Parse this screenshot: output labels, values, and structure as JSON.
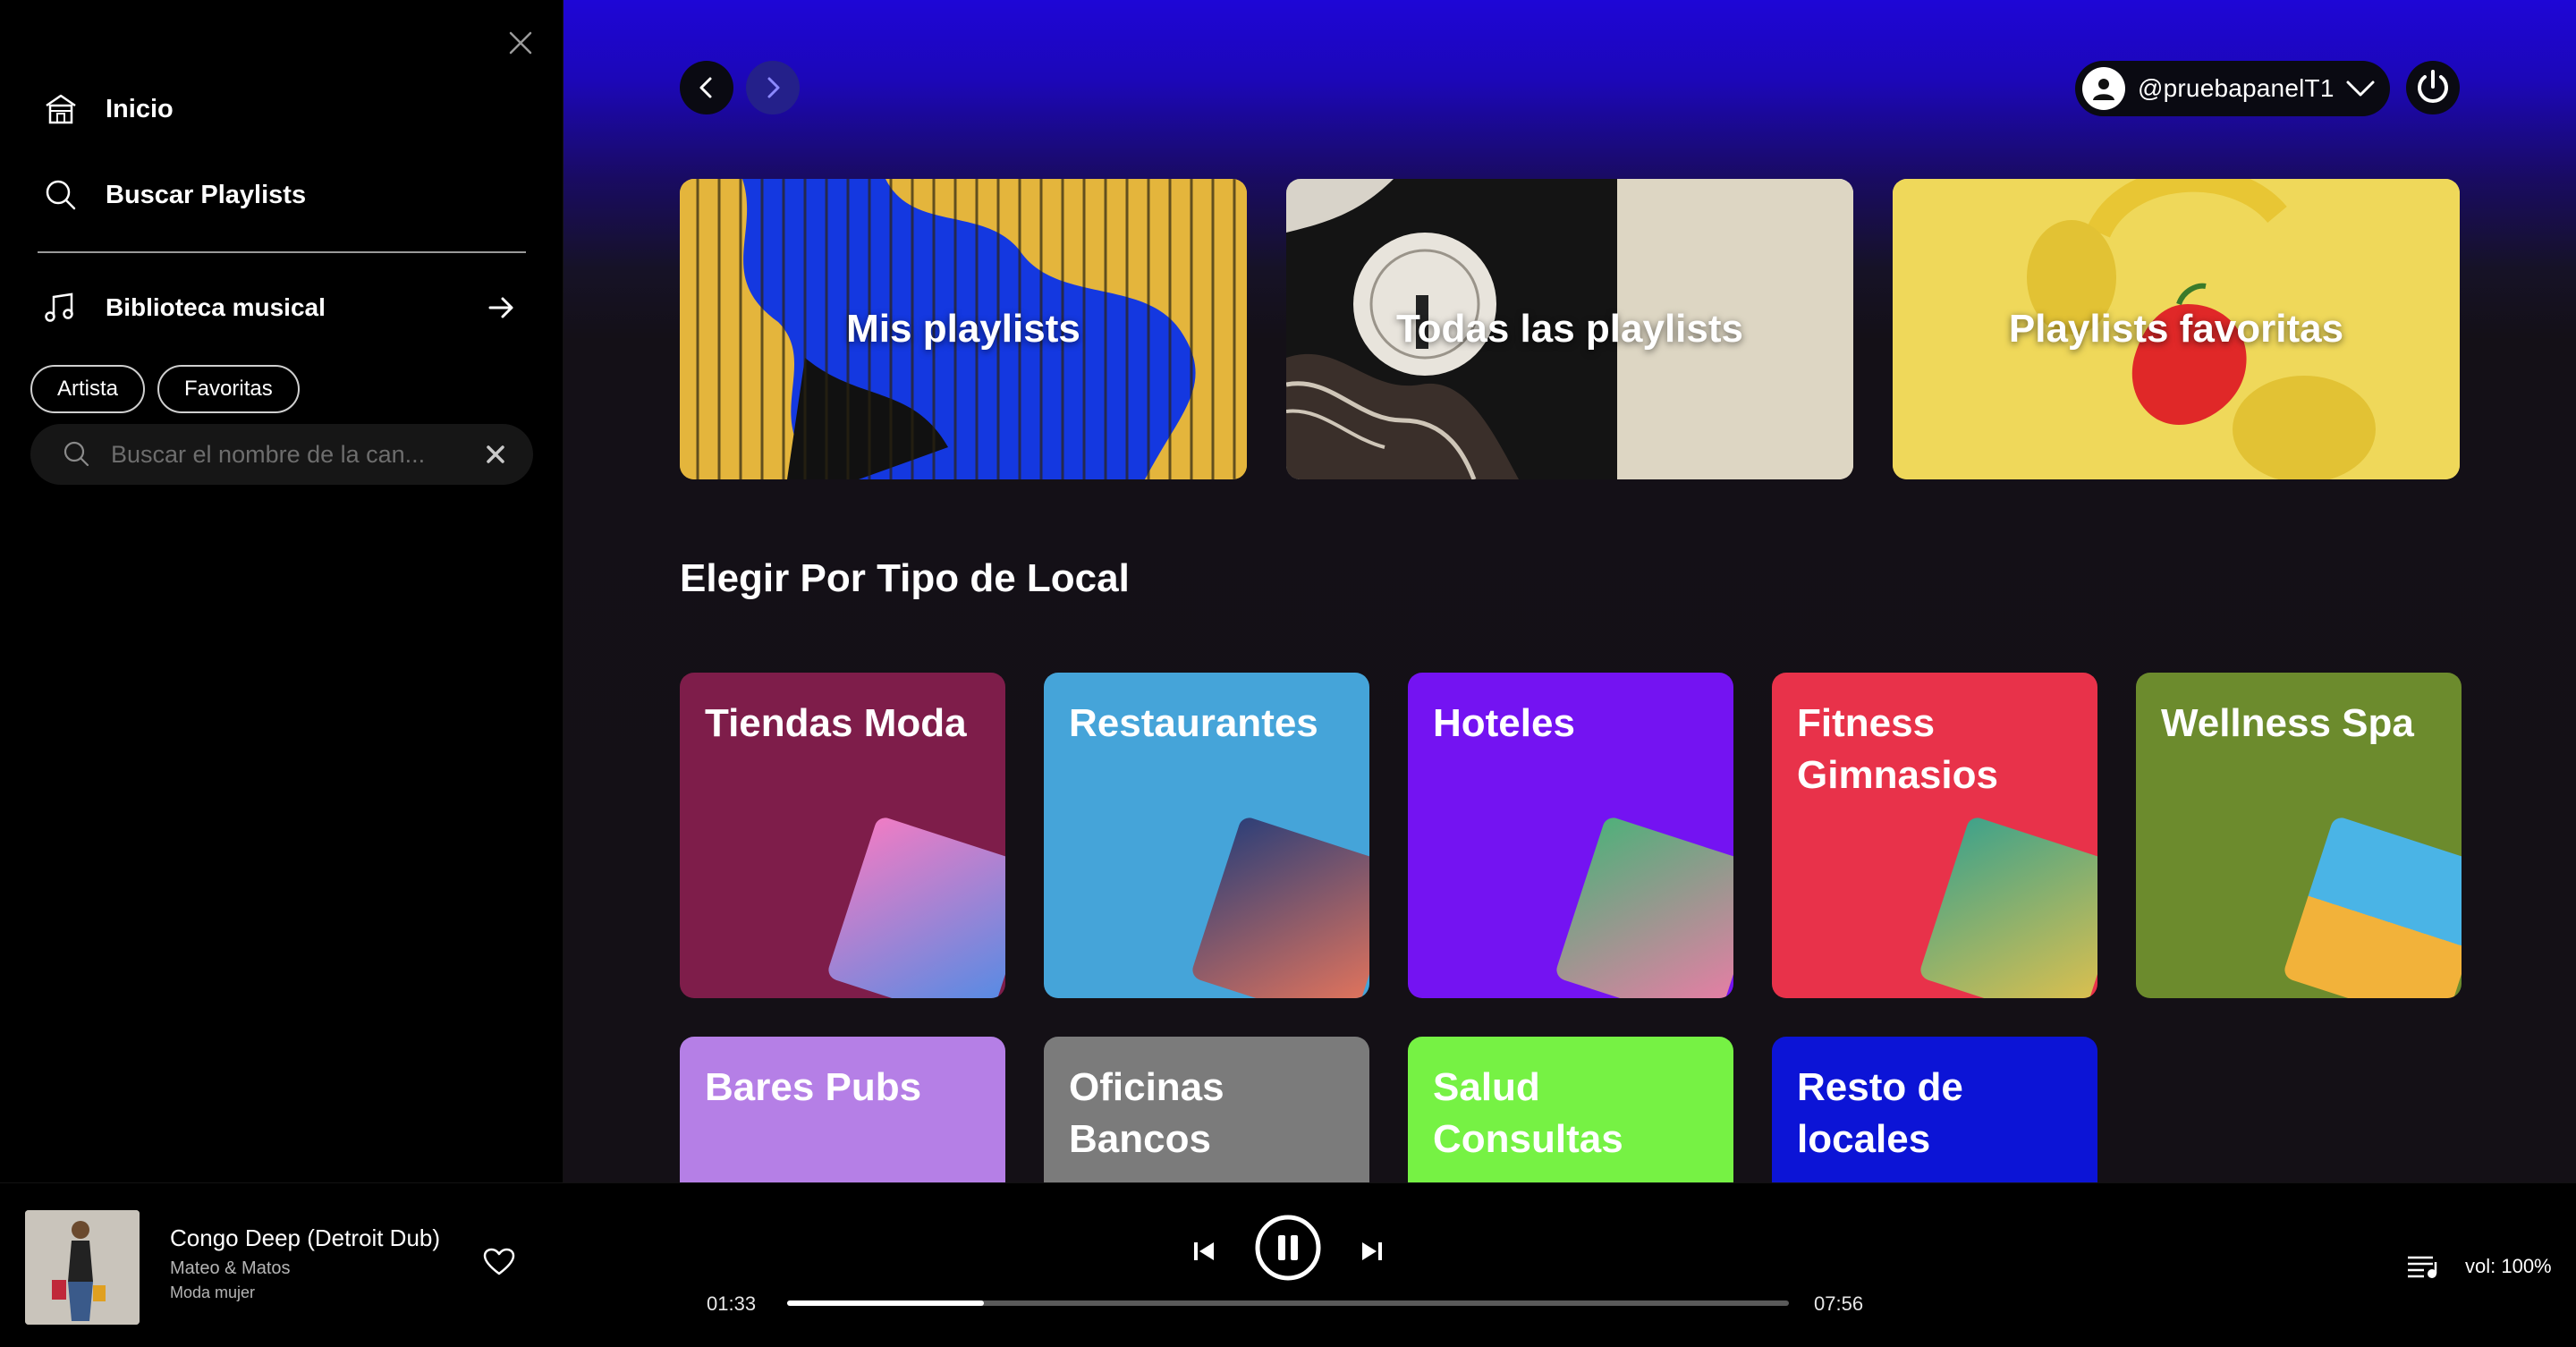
{
  "sidebar": {
    "nav": [
      {
        "label": "Inicio",
        "icon": "home-icon"
      },
      {
        "label": "Buscar Playlists",
        "icon": "search-icon"
      }
    ],
    "library": {
      "label": "Biblioteca musical",
      "icon": "music-note-icon"
    },
    "filters": [
      "Artista",
      "Favoritas"
    ],
    "search": {
      "placeholder": "Buscar el nombre de la can...",
      "value": ""
    }
  },
  "header": {
    "username": "@pruebapanelT1"
  },
  "hero_cards": [
    {
      "label": "Mis playlists"
    },
    {
      "label": "Todas las playlists"
    },
    {
      "label": "Playlists favoritas"
    }
  ],
  "section_title": "Elegir Por Tipo de Local",
  "categories": [
    {
      "label": "Tiendas Moda",
      "color": "#7e1d4a"
    },
    {
      "label": "Restaurantes",
      "color": "#45a4d9"
    },
    {
      "label": "Hoteles",
      "color": "#7413f2"
    },
    {
      "label": "Fitness Gimnasios",
      "color": "#e8324a"
    },
    {
      "label": "Wellness Spa",
      "color": "#6c8b2d"
    },
    {
      "label": "Bares Pubs",
      "color": "#b57fe6"
    },
    {
      "label": "Oficinas Bancos",
      "color": "#7b7b7b"
    },
    {
      "label": "Salud Consultas",
      "color": "#76f244"
    },
    {
      "label": "Resto de locales",
      "color": "#0c14d6"
    }
  ],
  "player": {
    "title": "Congo Deep (Detroit Dub)",
    "artist": "Mateo & Matos",
    "playlist": "Moda mujer",
    "current_time": "01:33",
    "total_time": "07:56",
    "progress": 0.196,
    "volume": "vol: 100%"
  }
}
